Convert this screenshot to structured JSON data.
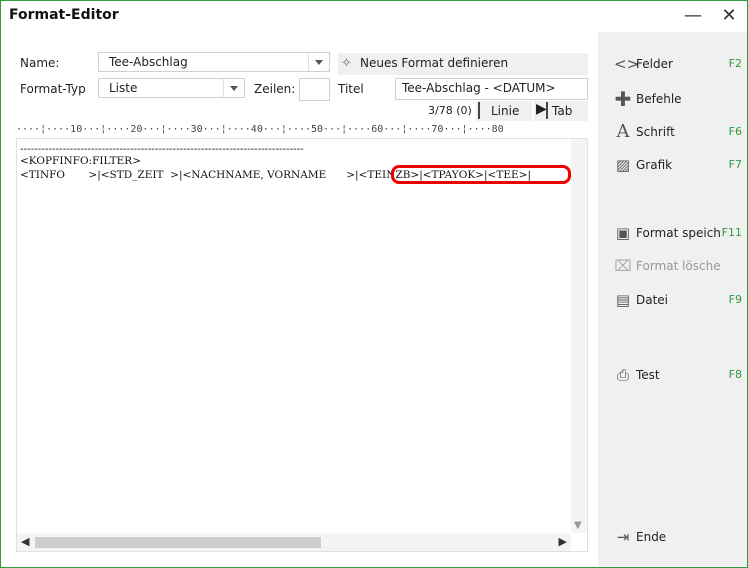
{
  "window": {
    "title": "Format-Editor",
    "minimize_glyph": "—",
    "close_glyph": "✕"
  },
  "form": {
    "name_label": "Name:",
    "name_value": "Tee-Abschlag",
    "new_format_label": "Neues Format definieren",
    "new_format_icon": "magic-wand-icon",
    "type_label": "Format-Typ",
    "type_value": "Liste",
    "rows_label": "Zeilen:",
    "rows_value": "",
    "title_label": "Titel",
    "title_value": "Tee-Abschlag - <DATUM>"
  },
  "toolbar": {
    "position": "3/78 (0)",
    "line_label": "Linie",
    "tab_label": "Tab"
  },
  "ruler": "····¦····10···¦····20···¦····30···¦····40···¦····50···¦····60···¦····70···¦····80",
  "editor": {
    "separator": "--------------------------------------------------------------------------------",
    "line1": "<KOPFINFO:FILTER>",
    "line2": "<TINFO       >|<STD_ZEIT  >|<NACHNAME, VORNAME      >|<TEINZB>|<TPAYOK>|<TEE>|"
  },
  "sidebar": {
    "items": [
      {
        "label": "Felder",
        "key": "F2",
        "icon": "code-brackets-icon"
      },
      {
        "label": "Befehle",
        "key": "",
        "icon": "plus-icon"
      },
      {
        "label": "Schrift",
        "key": "F6",
        "icon": "font-icon"
      },
      {
        "label": "Grafik",
        "key": "F7",
        "icon": "image-icon"
      },
      {
        "label": "Format speich",
        "key": "F11",
        "icon": "save-icon"
      },
      {
        "label": "Format lösche",
        "key": "",
        "icon": "trash-icon"
      },
      {
        "label": "Datei",
        "key": "F9",
        "icon": "folder-search-icon"
      },
      {
        "label": "Test",
        "key": "F8",
        "icon": "printer-icon"
      },
      {
        "label": "Ende",
        "key": "",
        "icon": "exit-icon"
      }
    ]
  },
  "colors": {
    "accent": "#2f9a3c",
    "highlight": "#e00000",
    "panel": "#f0f0f0"
  }
}
